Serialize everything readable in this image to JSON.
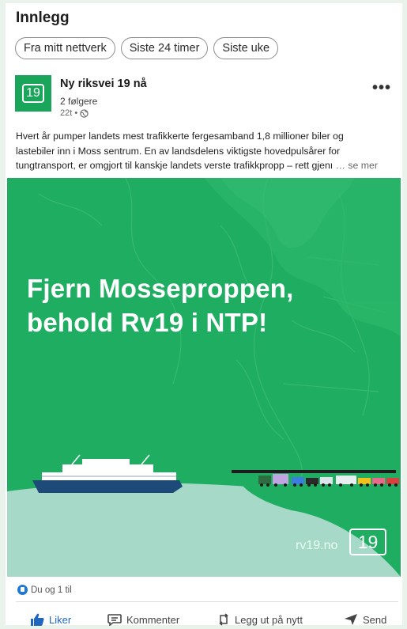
{
  "feed": {
    "heading": "Innlegg",
    "filters": [
      "Fra mitt nettverk",
      "Siste 24 timer",
      "Siste uke"
    ]
  },
  "post": {
    "logo_text": "19",
    "author": "Ny riksvei 19 nå",
    "followers": "2 følgere",
    "time": "22t •",
    "visibility_icon": "globe-icon",
    "menu_label": "•••",
    "text_lines": [
      "Hvert år pumper landets mest trafikkerte fergesamband 1,8 millioner biler og",
      "lastebiler inn i Moss sentrum. En av landsdelens viktigste hovedpulsårer for",
      "tungtransport, er omgjort til kanskje landets verste trafikkpropp – rett gjenı"
    ],
    "see_more": "… se mer",
    "image": {
      "headline_line1": "Fjern Mosseproppen,",
      "headline_line2": "behold Rv19 i NTP!",
      "site": "rv19.no",
      "badge": "19",
      "colors": {
        "green": "#1fad62",
        "water": "#a6d9c8"
      }
    },
    "reactions": "Du og 1 til",
    "actions": {
      "like": "Liker",
      "comment": "Kommenter",
      "repost": "Legg ut på nytt",
      "send": "Send"
    }
  }
}
